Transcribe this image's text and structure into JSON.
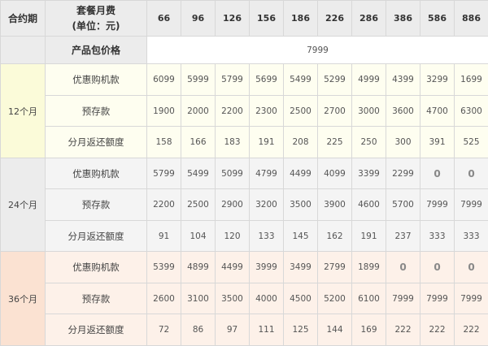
{
  "header": {
    "term_label": "合约期",
    "fee_label_line1": "套餐月费",
    "fee_label_line2": "(单位：元)",
    "plans": [
      "66",
      "96",
      "126",
      "156",
      "186",
      "226",
      "286",
      "386",
      "586",
      "886"
    ]
  },
  "price_row": {
    "label": "产品包价格",
    "value": "7999"
  },
  "terms": [
    {
      "label": "12个月",
      "rows": [
        {
          "label": "优惠购机款",
          "values": [
            "6099",
            "5999",
            "5799",
            "5699",
            "5499",
            "5299",
            "4999",
            "4399",
            "3299",
            "1699"
          ]
        },
        {
          "label": "预存款",
          "values": [
            "1900",
            "2000",
            "2200",
            "2300",
            "2500",
            "2700",
            "3000",
            "3600",
            "4700",
            "6300"
          ]
        },
        {
          "label": "分月返还额度",
          "values": [
            "158",
            "166",
            "183",
            "191",
            "208",
            "225",
            "250",
            "300",
            "391",
            "525"
          ]
        }
      ]
    },
    {
      "label": "24个月",
      "rows": [
        {
          "label": "优惠购机款",
          "values": [
            "5799",
            "5499",
            "5099",
            "4799",
            "4499",
            "4099",
            "3399",
            "2299",
            "0",
            "0"
          ]
        },
        {
          "label": "预存款",
          "values": [
            "2200",
            "2500",
            "2900",
            "3200",
            "3500",
            "3900",
            "4600",
            "5700",
            "7999",
            "7999"
          ]
        },
        {
          "label": "分月返还额度",
          "values": [
            "91",
            "104",
            "120",
            "133",
            "145",
            "162",
            "191",
            "237",
            "333",
            "333"
          ]
        }
      ]
    },
    {
      "label": "36个月",
      "rows": [
        {
          "label": "优惠购机款",
          "values": [
            "5399",
            "4899",
            "4499",
            "3999",
            "3499",
            "2799",
            "1899",
            "0",
            "0",
            "0"
          ]
        },
        {
          "label": "预存款",
          "values": [
            "2600",
            "3100",
            "3500",
            "4000",
            "4500",
            "5200",
            "6100",
            "7999",
            "7999",
            "7999"
          ]
        },
        {
          "label": "分月返还额度",
          "values": [
            "72",
            "86",
            "97",
            "111",
            "125",
            "144",
            "169",
            "222",
            "222",
            "222"
          ]
        }
      ]
    }
  ]
}
